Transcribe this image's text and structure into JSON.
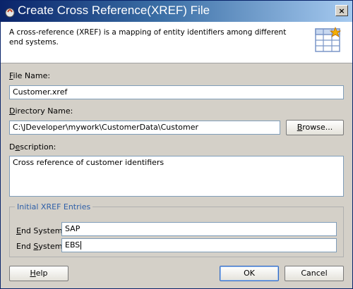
{
  "window": {
    "title": "Create Cross Reference(XREF) File",
    "close_label": "×"
  },
  "header": {
    "description": "A cross-reference (XREF) is a mapping of entity identifiers among different end systems.",
    "icon": "xref-table-icon"
  },
  "form": {
    "file_name_label_prefix": "",
    "file_name_label_mnemonic": "F",
    "file_name_label_rest": "ile Name:",
    "file_name_value": "Customer.xref",
    "directory_label_prefix": "",
    "directory_label_mnemonic": "D",
    "directory_label_rest": "irectory Name:",
    "directory_value": "C:\\JDeveloper\\mywork\\CustomerData\\Customer",
    "browse_label_prefix": "",
    "browse_label_mnemonic": "B",
    "browse_label_rest": "rowse...",
    "description_label_prefix": "D",
    "description_label_mnemonic": "e",
    "description_label_rest": "scription:",
    "description_value": "Cross reference of customer identifiers"
  },
  "entries": {
    "group_title": "Initial XREF Entries",
    "rows": [
      {
        "label_prefix": "",
        "label_mnemonic": "E",
        "label_rest": "nd System:",
        "value": "SAP"
      },
      {
        "label_prefix": "End ",
        "label_mnemonic": "S",
        "label_rest": "ystem:",
        "value": "EBS"
      }
    ]
  },
  "buttons": {
    "help_prefix": "",
    "help_mnemonic": "H",
    "help_rest": "elp",
    "ok": "OK",
    "cancel": "Cancel"
  },
  "colors": {
    "title_bar_start": "#0a246a",
    "title_bar_end": "#a6caf0",
    "dialog_bg": "#d4d0c8",
    "group_title": "#2e5fa8"
  }
}
